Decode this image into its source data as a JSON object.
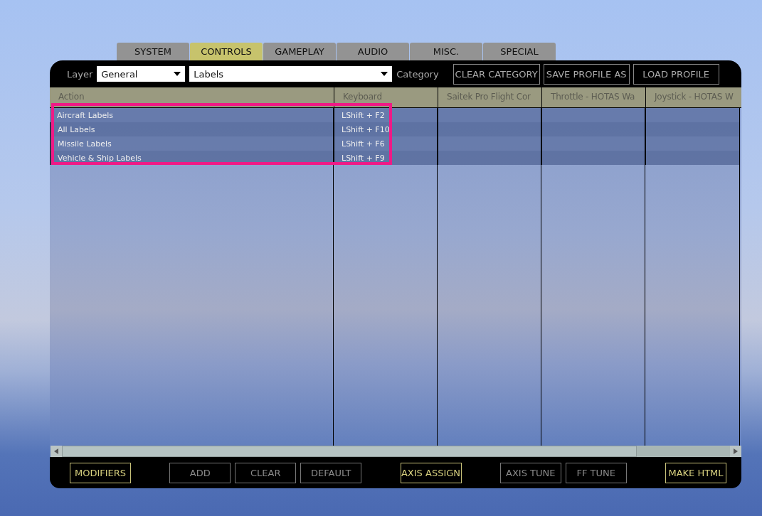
{
  "tabs": [
    {
      "label": "SYSTEM",
      "selected": false
    },
    {
      "label": "CONTROLS",
      "selected": true
    },
    {
      "label": "GAMEPLAY",
      "selected": false
    },
    {
      "label": "AUDIO",
      "selected": false
    },
    {
      "label": "MISC.",
      "selected": false
    },
    {
      "label": "SPECIAL",
      "selected": false
    }
  ],
  "toolbar": {
    "layer_label": "Layer",
    "layer_value": "General",
    "category_value": "Labels",
    "category_label": "Category",
    "buttons": [
      "CLEAR CATEGORY",
      "SAVE PROFILE AS",
      "LOAD PROFILE"
    ]
  },
  "table": {
    "columns": [
      "Action",
      "Keyboard",
      "Saitek Pro Flight Cor",
      "Throttle - HOTAS Wa",
      "Joystick - HOTAS W"
    ],
    "rows": [
      [
        "Aircraft Labels",
        "LShift + F2"
      ],
      [
        "All Labels",
        "LShift + F10"
      ],
      [
        "Missile Labels",
        "LShift + F6"
      ],
      [
        "Vehicle & Ship Labels",
        "LShift + F9"
      ]
    ]
  },
  "bottom_bar": [
    [
      {
        "label": "MODIFIERS",
        "disabled": false
      }
    ],
    [
      {
        "label": "ADD",
        "disabled": true
      },
      {
        "label": "CLEAR",
        "disabled": true
      },
      {
        "label": "DEFAULT",
        "disabled": true
      }
    ],
    [
      {
        "label": "AXIS ASSIGN",
        "disabled": false
      }
    ],
    [
      {
        "label": "AXIS TUNE",
        "disabled": true
      },
      {
        "label": "FF TUNE",
        "disabled": true
      }
    ],
    [
      {
        "label": "MAKE HTML",
        "disabled": false
      }
    ]
  ]
}
